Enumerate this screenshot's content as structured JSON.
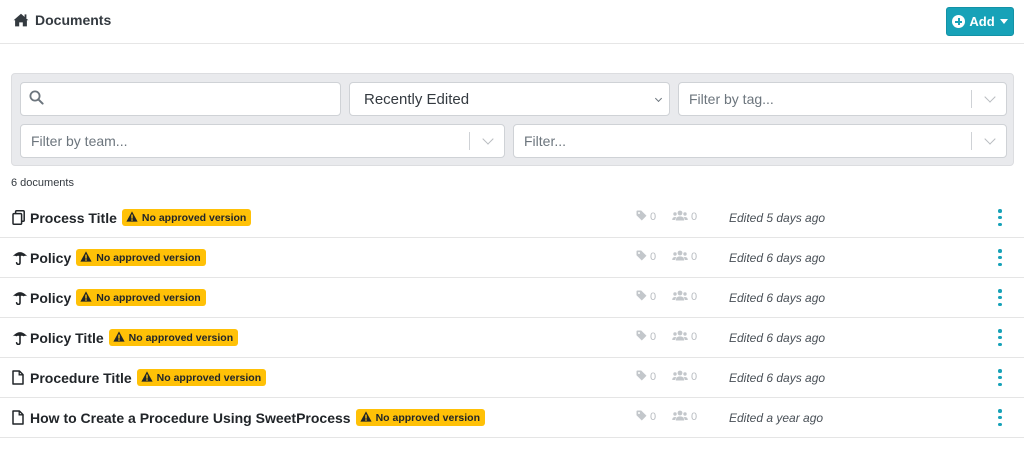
{
  "header": {
    "title": "Documents",
    "icon": "home-icon",
    "add_label": "Add",
    "accent": "#17a2b8"
  },
  "filters": {
    "search_placeholder": "",
    "sort_value": "Recently Edited",
    "tag_placeholder": "Filter by tag...",
    "team_placeholder": "Filter by team...",
    "filter_placeholder": "Filter..."
  },
  "count_label": "6 documents",
  "documents": [
    {
      "title": "Process Title",
      "type": "process",
      "badge": "No approved version",
      "tags": "0",
      "teams": "0",
      "edited": "Edited 5 days ago"
    },
    {
      "title": "Policy",
      "type": "policy",
      "badge": "No approved version",
      "tags": "0",
      "teams": "0",
      "edited": "Edited 6 days ago"
    },
    {
      "title": "Policy",
      "type": "policy",
      "badge": "No approved version",
      "tags": "0",
      "teams": "0",
      "edited": "Edited 6 days ago"
    },
    {
      "title": "Policy Title",
      "type": "policy",
      "badge": "No approved version",
      "tags": "0",
      "teams": "0",
      "edited": "Edited 6 days ago"
    },
    {
      "title": "Procedure Title",
      "type": "procedure",
      "badge": "No approved version",
      "tags": "0",
      "teams": "0",
      "edited": "Edited 6 days ago"
    },
    {
      "title": "How to Create a Procedure Using SweetProcess",
      "type": "procedure",
      "badge": "No approved version",
      "tags": "0",
      "teams": "0",
      "edited": "Edited a year ago"
    }
  ],
  "colors": {
    "badge": "#ffc107",
    "kebab": "#17a2b8"
  }
}
